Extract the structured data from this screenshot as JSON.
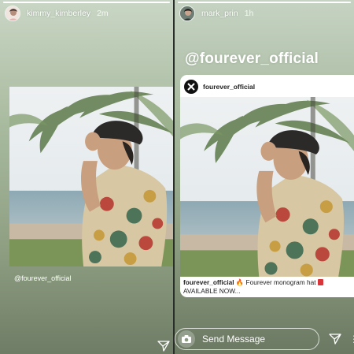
{
  "left_story": {
    "username": "kimmy_kimberley",
    "time": "2m",
    "progress": 1.0,
    "mention": "@fourever_official",
    "avatar_icon": "profile-avatar",
    "send_icon": "paper-plane-icon"
  },
  "right_story": {
    "username": "mark_prin",
    "time": "1h",
    "big_mention": "@fourever_official",
    "post": {
      "account": "fourever_official",
      "caption_account": "fourever_official",
      "caption_text": " Fourever monogram hat ",
      "caption_line2": "AVAILABLE NOW..."
    },
    "message_placeholder": "Send Message",
    "camera_icon": "camera-icon",
    "send_icon": "paper-plane-icon"
  },
  "colors": {
    "background_top": "#c6d3c3",
    "background_bottom": "#6b7862",
    "text": "#ffffff"
  }
}
